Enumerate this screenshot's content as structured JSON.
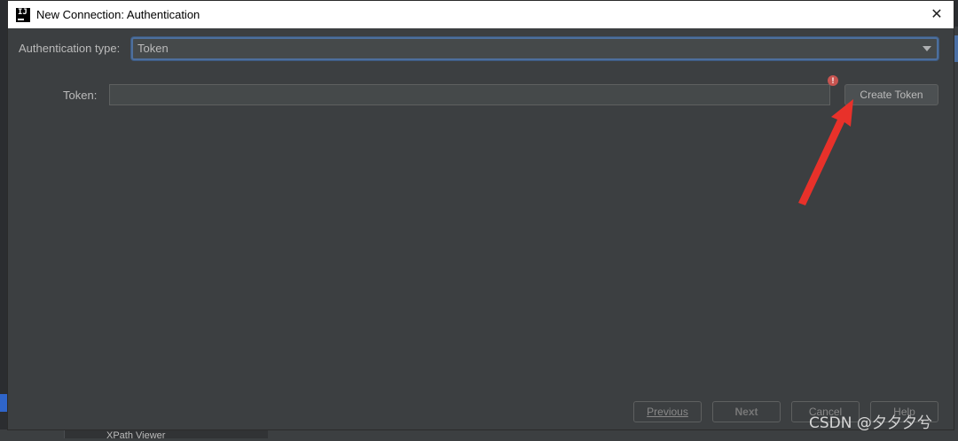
{
  "window": {
    "title": "New Connection: Authentication",
    "app_icon": "intellij-icon",
    "app_icon_text": "IJ",
    "close_icon": "close-icon",
    "close_glyph": "✕"
  },
  "form": {
    "auth_type_label": "Authentication type:",
    "auth_type_value": "Token",
    "token_label": "Token:",
    "token_value": "",
    "error_glyph": "!",
    "create_token_label": "Create Token"
  },
  "footer": {
    "previous_label": "Previous",
    "next_label": "Next",
    "cancel_label": "Cancel",
    "help_label": "Help"
  },
  "background": {
    "bottom_panel_text": "XPath Viewer"
  },
  "watermark": "CSDN @夕夕夕兮",
  "colors": {
    "dialog_bg": "#3c3f41",
    "field_bg": "#45494a",
    "focus_border": "#4d6f9d",
    "error_red": "#c75450",
    "annotation_red": "#e8312a",
    "text": "#bbbbbb"
  }
}
